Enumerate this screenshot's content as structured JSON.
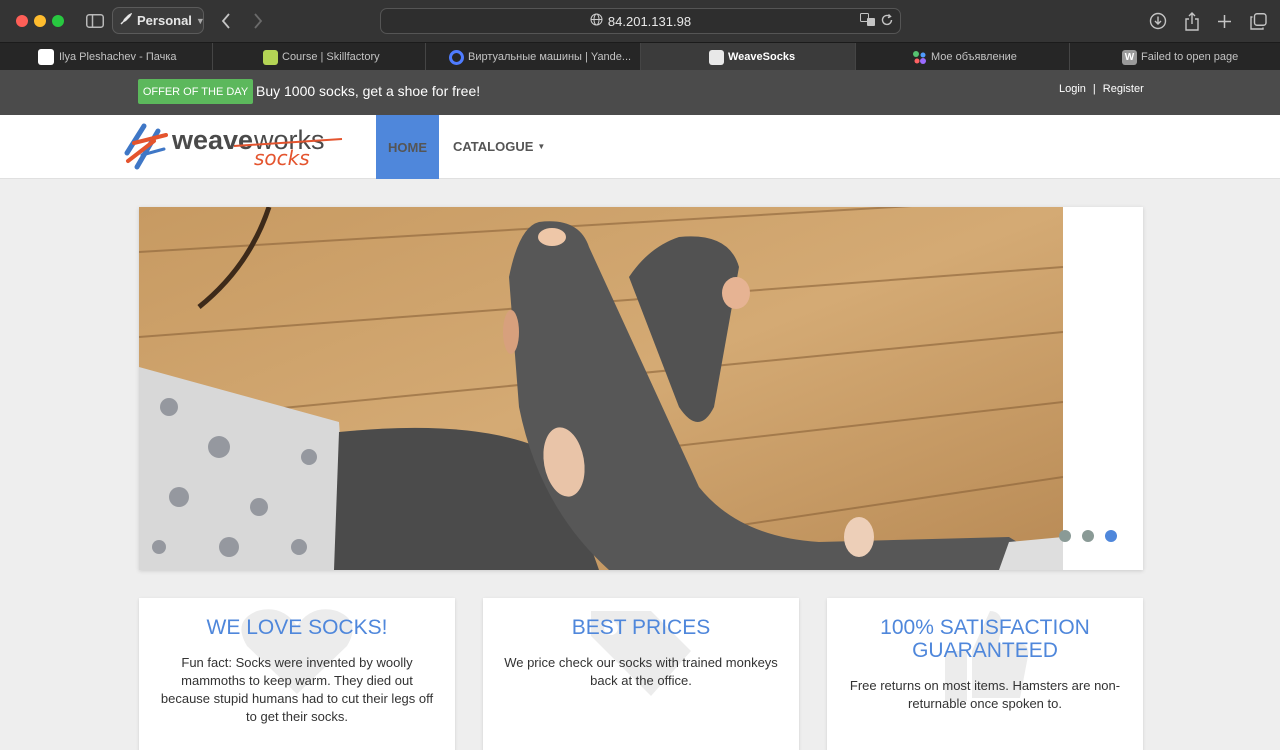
{
  "browser": {
    "profile_label": "Personal",
    "address": "84.201.131.98",
    "tabs": [
      {
        "label": "Ilya Pleshachev - Пачка",
        "color": "#eaeaea"
      },
      {
        "label": "Course | Skillfactory",
        "color": "#b4d455"
      },
      {
        "label": "Виртуальные машины | Yande...",
        "color": "#4f7cff"
      },
      {
        "label": "WeaveSocks",
        "color": "#e8e8e8",
        "active": true
      },
      {
        "label": "Мое объявление",
        "color": "#56c271"
      },
      {
        "label": "Failed to open page",
        "color": "#9a9a9a"
      }
    ]
  },
  "offer": {
    "badge": "OFFER OF THE DAY",
    "text": "Buy 1000 socks, get a shoe for free!"
  },
  "auth": {
    "login": "Login",
    "separator": "|",
    "register": "Register"
  },
  "logo": {
    "word1": "weave",
    "word2": "works",
    "word3": "socks"
  },
  "nav": {
    "home": "HOME",
    "catalogue": "CATALOGUE"
  },
  "carousel": {
    "slide_count": 3,
    "active_index": 2
  },
  "features": [
    {
      "title": "WE LOVE SOCKS!",
      "text": "Fun fact: Socks were invented by woolly mammoths to keep warm. They died out because stupid humans had to cut their legs off to get their socks."
    },
    {
      "title": "BEST PRICES",
      "text": "We price check our socks with trained monkeys back at the office."
    },
    {
      "title": "100% SATISFACTION GUARANTEED",
      "text": "Free returns on most items. Hamsters are non-returnable once spoken to."
    }
  ],
  "colors": {
    "accent_blue": "#4f87db",
    "offer_green": "#5cb85c",
    "logo_orange": "#e4542e"
  }
}
